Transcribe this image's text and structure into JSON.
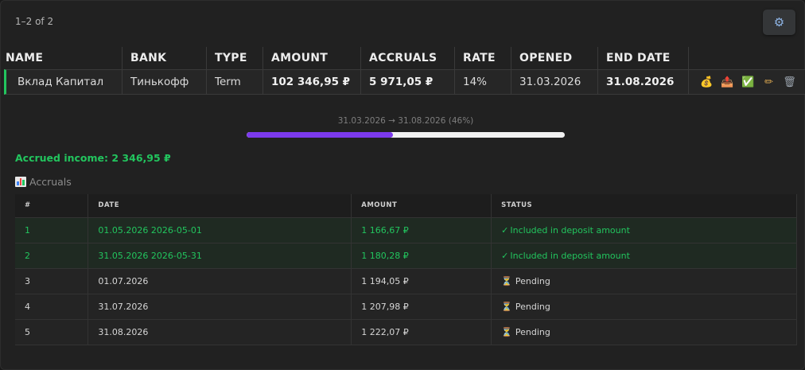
{
  "pagination": {
    "text": "1–2 of 2"
  },
  "settings": {
    "icon": "gear-icon",
    "glyph": "⚙"
  },
  "main_table": {
    "headers": [
      "NAME",
      "BANK",
      "TYPE",
      "AMOUNT",
      "ACCRUALS",
      "RATE",
      "OPENED",
      "END DATE",
      ""
    ],
    "row": {
      "name": "Вклад Капитал",
      "bank": "Тинькофф",
      "type": "Term",
      "amount": "102 346,95 ₽",
      "accruals": "5 971,05 ₽",
      "rate": "14%",
      "opened": "31.03.2026",
      "end_date": "31.08.2026",
      "accent_color": "#22c55e"
    },
    "actions": [
      {
        "icon": "money-bag-icon",
        "glyph": "💰"
      },
      {
        "icon": "withdraw-tray-icon",
        "glyph": "📤"
      },
      {
        "icon": "check-icon",
        "glyph": "✅"
      },
      {
        "icon": "pencil-icon",
        "glyph": "✏"
      },
      {
        "icon": "trash-icon",
        "glyph": "🗑"
      }
    ]
  },
  "progress": {
    "label": "31.03.2026 → 31.08.2026 (46%)",
    "fraction": 0.46,
    "fill_color": "#7c3aed"
  },
  "accrued_income": "Accrued income: 2 346,95 ₽",
  "accruals_section": {
    "title": "Accruals",
    "icon": "bar-chart-icon",
    "headers": [
      "#",
      "DATE",
      "AMOUNT",
      "STATUS"
    ],
    "rows": [
      {
        "num": "1",
        "date": "01.05.2026 2026-05-01",
        "amount": "1 166,67 ₽",
        "status": "Included in deposit amount",
        "state": "included"
      },
      {
        "num": "2",
        "date": "31.05.2026 2026-05-31",
        "amount": "1 180,28 ₽",
        "status": "Included in deposit amount",
        "state": "included"
      },
      {
        "num": "3",
        "date": "01.07.2026",
        "amount": "1 194,05 ₽",
        "status": "Pending",
        "state": "pending"
      },
      {
        "num": "4",
        "date": "31.07.2026",
        "amount": "1 207,98 ₽",
        "status": "Pending",
        "state": "pending"
      },
      {
        "num": "5",
        "date": "31.08.2026",
        "amount": "1 222,07 ₽",
        "status": "Pending",
        "state": "pending"
      }
    ]
  },
  "colors": {
    "success": "#22c55e",
    "background": "#212121"
  }
}
